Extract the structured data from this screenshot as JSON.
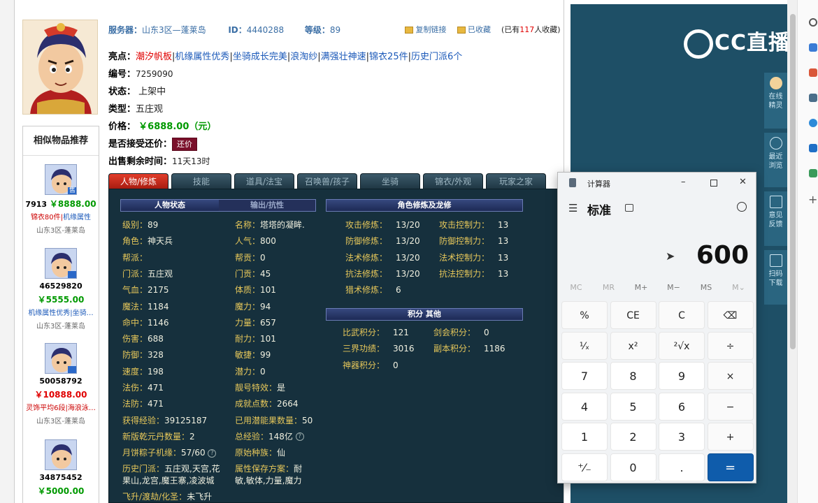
{
  "header": {
    "server_label": "服务器：",
    "server_value": "山东3区—蓬莱岛",
    "id_label": "ID：",
    "id_value": "4440288",
    "level_label": "等级：",
    "level_value": "89",
    "copy_link": "复制链接",
    "favorited": "已收藏",
    "fav_count_prefix": "(已有",
    "fav_count": "117",
    "fav_count_suffix": "人收藏)"
  },
  "item": {
    "highlights_label": "亮点：",
    "highlights": [
      "潮汐帆板",
      "机缘属性优秀",
      "坐骑成长完美",
      "浪淘纱",
      "满强壮神速",
      "锦衣25件",
      "历史门派6个"
    ],
    "number_label": "编号：",
    "number_value": "7259090",
    "status_label": "状态：",
    "status_value": "上架中",
    "type_label": "类型：",
    "type_value": "五庄观",
    "price_label": "价格：",
    "price_value": "￥6888.00（元）",
    "bargain_label": "是否接受还价：",
    "bargain_button": "还价",
    "remaining_label": "出售剩余时间：",
    "remaining_value": "11天13时"
  },
  "recommend": {
    "title": "相似物品推荐",
    "badge": "售",
    "items": [
      {
        "id": "7913",
        "price": "￥8888.00",
        "tag_red": "锦衣80件",
        "tag_blue": "机缘属性",
        "server": "山东3区-蓬莱岛"
      },
      {
        "id": "46529820",
        "price": "￥5555.00",
        "tag_red": "",
        "tag_blue": "机缘属性优秀|坐骑…",
        "server": "山东3区-蓬莱岛"
      },
      {
        "id": "50058792",
        "price": "￥10888.00",
        "tag_red": "灵饰平均6段|海浪泳…",
        "tag_blue": "",
        "server": "山东3区-蓬莱岛"
      },
      {
        "id": "34875452",
        "price": "￥5000.00",
        "tag_red": "",
        "tag_blue": "",
        "server": ""
      }
    ]
  },
  "tabs": [
    "人物/修炼",
    "技能",
    "道具/法宝",
    "召唤兽/孩子",
    "坐骑",
    "锦衣/外观",
    "玩家之家"
  ],
  "panel": {
    "hdr_status": "人物状态",
    "hdr_output": "输出/抗性",
    "hdr_cultivation": "角色修炼及龙修",
    "hdr_points": "积分 其他",
    "left_col": [
      {
        "k": "级别：",
        "v": "89"
      },
      {
        "k": "角色：",
        "v": "神天兵"
      },
      {
        "k": "帮派：",
        "v": ""
      },
      {
        "k": "门派：",
        "v": "五庄观"
      },
      {
        "k": "气血：",
        "v": "2175"
      },
      {
        "k": "魔法：",
        "v": "1184"
      },
      {
        "k": "命中：",
        "v": "1146"
      },
      {
        "k": "伤害：",
        "v": "688"
      },
      {
        "k": "防御：",
        "v": "328"
      },
      {
        "k": "速度：",
        "v": "198"
      },
      {
        "k": "法伤：",
        "v": "471"
      },
      {
        "k": "法防：",
        "v": "471"
      },
      {
        "k": "获得经验：",
        "v": "39125187"
      },
      {
        "k": "新版乾元丹数量：",
        "v": "2"
      },
      {
        "k": "月饼粽子机缘：",
        "v": "57/60"
      }
    ],
    "right_col": [
      {
        "k": "名称：",
        "v": "塔塔的凝眸."
      },
      {
        "k": "人气：",
        "v": "800"
      },
      {
        "k": "帮贡：",
        "v": "0"
      },
      {
        "k": "门贡：",
        "v": "45"
      },
      {
        "k": "体质：",
        "v": "101"
      },
      {
        "k": "魔力：",
        "v": "94"
      },
      {
        "k": "力量：",
        "v": "657"
      },
      {
        "k": "耐力：",
        "v": "101"
      },
      {
        "k": "敏捷：",
        "v": "99"
      },
      {
        "k": "潜力：",
        "v": "0"
      },
      {
        "k": "靓号特效：",
        "v": "是"
      },
      {
        "k": "成就点数：",
        "v": "2664"
      },
      {
        "k": "已用潜能果数量：",
        "v": "50"
      },
      {
        "k": "总经验：",
        "v": "148亿"
      },
      {
        "k": "原始种族：",
        "v": "仙"
      }
    ],
    "history_label": "历史门派：",
    "history_line1": "五庄观,天宫,花",
    "history_line2": "果山,龙宫,魔王寨,凌波城",
    "scheme_label": "属性保存方案：",
    "scheme_line1": "耐",
    "scheme_line2": "敏,敏体,力量,魔力",
    "ascend_label": "飞升/渡劫/化圣：",
    "ascend_value": "未飞升",
    "cult_rows": [
      {
        "k1": "攻击修炼：",
        "v1": "13/20",
        "k2": "攻击控制力：",
        "v2": "13"
      },
      {
        "k1": "防御修炼：",
        "v1": "13/20",
        "k2": "防御控制力：",
        "v2": "13"
      },
      {
        "k1": "法术修炼：",
        "v1": "13/20",
        "k2": "法术控制力：",
        "v2": "13"
      },
      {
        "k1": "抗法修炼：",
        "v1": "13/20",
        "k2": "抗法控制力：",
        "v2": "13"
      },
      {
        "k1": "猎术修炼：",
        "v1": "6",
        "k2": "",
        "v2": ""
      }
    ],
    "points_rows": [
      {
        "k1": "比武积分：",
        "v1": "121",
        "k2": "剑会积分：",
        "v2": "0"
      },
      {
        "k1": "三界功绩：",
        "v1": "3016",
        "k2": "副本积分：",
        "v2": "1186"
      },
      {
        "k1": "神器积分：",
        "v1": "0",
        "k2": "",
        "v2": ""
      }
    ]
  },
  "stream": {
    "logo_text": "CC直播",
    "tools": [
      {
        "label1": "在线",
        "label2": "精灵"
      },
      {
        "label1": "最近",
        "label2": "浏览"
      },
      {
        "label1": "意见",
        "label2": "反馈"
      },
      {
        "label1": "扫码",
        "label2": "下载"
      }
    ]
  },
  "calculator": {
    "title": "计算器",
    "mode": "标准",
    "display": "600",
    "memory": [
      "MC",
      "MR",
      "M+",
      "M−",
      "MS",
      "M⌄"
    ],
    "keys": [
      [
        "%",
        "CE",
        "C",
        "⌫"
      ],
      [
        "¹⁄ₓ",
        "x²",
        "²√x",
        "÷"
      ],
      [
        "7",
        "8",
        "9",
        "×"
      ],
      [
        "4",
        "5",
        "6",
        "−"
      ],
      [
        "1",
        "2",
        "3",
        "+"
      ],
      [
        "⁺⁄₋",
        "0",
        ".",
        "="
      ]
    ]
  },
  "colors": {
    "panel_bg": "#16303d",
    "tab_active": "#e23d2b",
    "price_green": "#009900",
    "calc_equals": "#0f5cab"
  }
}
